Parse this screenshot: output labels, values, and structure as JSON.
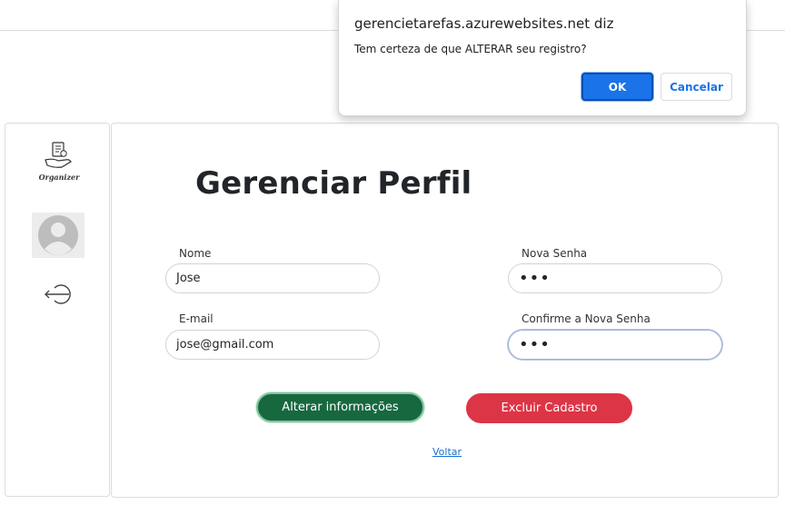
{
  "dialog": {
    "origin": "gerencietarefas.azurewebsites.net diz",
    "message": "Tem certeza de que ALTERAR seu registro?",
    "ok_label": "OK",
    "cancel_label": "Cancelar",
    "accent_color": "#1a73e8"
  },
  "sidebar": {
    "logo_text": "Organizer",
    "icons": [
      "organizer-logo-icon",
      "user-avatar-icon",
      "logout-icon"
    ]
  },
  "profile": {
    "title": "Gerenciar Perfil",
    "fields": {
      "name": {
        "label": "Nome",
        "value": "Jose"
      },
      "email": {
        "label": "E-mail",
        "value": "jose@gmail.com"
      },
      "new_password": {
        "label": "Nova Senha",
        "value": "•••"
      },
      "confirm_password": {
        "label": "Confirme a Nova Senha",
        "value": "•••"
      }
    },
    "update_button": "Alterar informações",
    "delete_button": "Excluir Cadastro",
    "back_link": "Voltar"
  },
  "colors": {
    "update_button": "#17683f",
    "delete_button": "#dc3545",
    "link": "#1a6fd0"
  }
}
